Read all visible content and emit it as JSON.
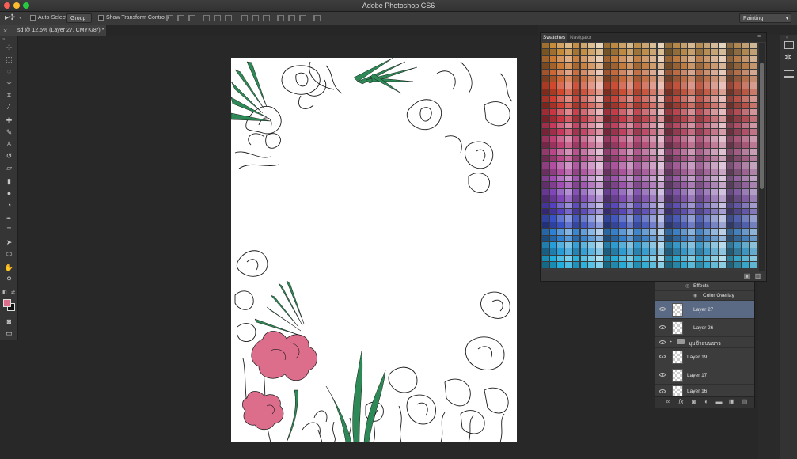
{
  "window": {
    "title": "Adobe Photoshop CS6"
  },
  "options_bar": {
    "auto_select_label": "Auto-Select:",
    "auto_select_value": "Group",
    "transform_label": "Show Transform Controls",
    "workspace": "Painting"
  },
  "document_tab": {
    "title": "sd @ 12.5% (Layer 27, CMYK/8*) *",
    "close_glyph": "×"
  },
  "colors": {
    "foreground": "#dc6d8b",
    "background": "#111111",
    "accent_selected": "#5a6a84"
  },
  "swatches_panel": {
    "tabs": [
      {
        "label": "Swatches",
        "active": true
      },
      {
        "label": "Navigator",
        "active": false
      }
    ]
  },
  "layers_panel": {
    "effects_label": "Effects",
    "effect_item": "Color Overlay",
    "layers": [
      {
        "name": "Layer 27",
        "selected": true
      },
      {
        "name": "Layer 26",
        "selected": false
      },
      {
        "name": "มุมซ้ายบนขาว",
        "type": "group"
      },
      {
        "name": "Layer 19",
        "selected": false
      },
      {
        "name": "Layer 17",
        "selected": false
      },
      {
        "name": "Layer 16",
        "selected": false
      }
    ],
    "footer_fx": "fx"
  }
}
